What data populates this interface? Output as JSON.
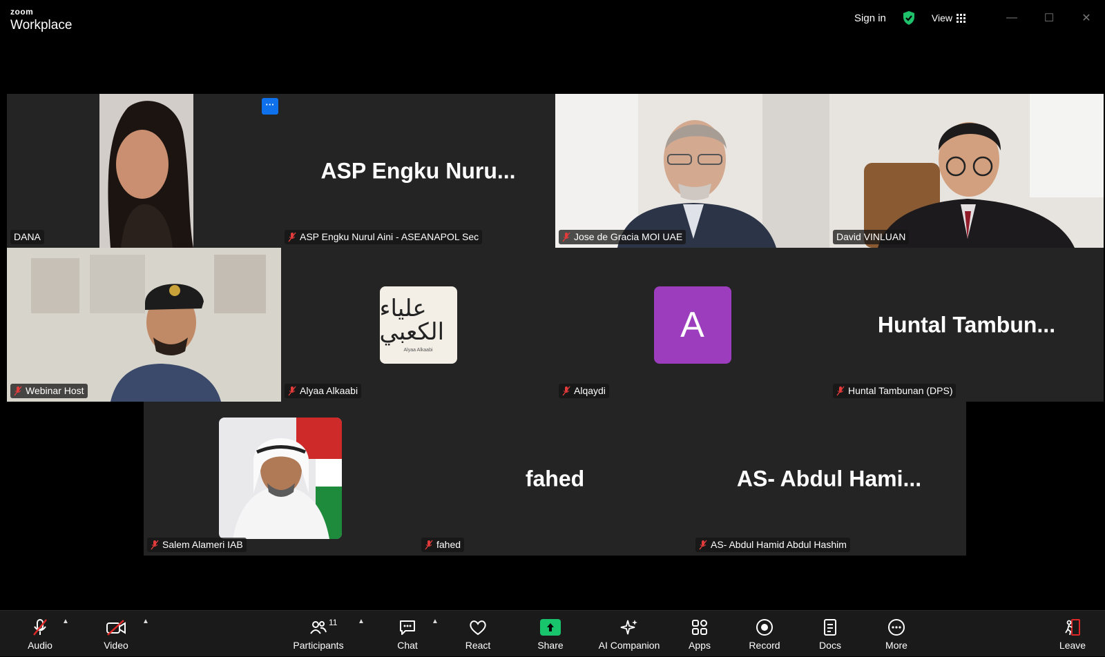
{
  "app": {
    "logo_small": "zoom",
    "logo_main": "Workplace"
  },
  "titlebar": {
    "signin": "Sign in",
    "view": "View"
  },
  "tiles": {
    "dana": {
      "caption": "DANA"
    },
    "asp": {
      "big": "ASP Engku Nuru...",
      "caption": "ASP Engku Nurul Aini - ASEANAPOL Sec"
    },
    "jose": {
      "caption": "Jose de Gracia MOI UAE"
    },
    "david": {
      "caption": "David VINLUAN"
    },
    "host": {
      "caption": "Webinar Host"
    },
    "alyaa": {
      "caption": "Alyaa Alkaabi",
      "logo_text": "علياء الكعبي",
      "logo_sub": "Alyaa Alkaabi"
    },
    "alqaydi": {
      "caption": "Alqaydi",
      "letter": "A"
    },
    "huntal": {
      "big": "Huntal Tambun...",
      "caption": "Huntal Tambunan (DPS)"
    },
    "salem": {
      "caption": "Salem Alameri IAB"
    },
    "fahed": {
      "big": "fahed",
      "caption": "fahed"
    },
    "abdul": {
      "big": "AS- Abdul Hami...",
      "caption": "AS- Abdul Hamid Abdul Hashim"
    }
  },
  "toolbar": {
    "audio": "Audio",
    "video": "Video",
    "participants": "Participants",
    "participants_count": "11",
    "chat": "Chat",
    "react": "React",
    "share": "Share",
    "ai": "AI Companion",
    "apps": "Apps",
    "record": "Record",
    "docs": "Docs",
    "more": "More",
    "leave": "Leave"
  },
  "colors": {
    "active_border": "#1fdc8b",
    "share_green": "#19c56c",
    "avatar_purple": "#9b3dbd",
    "leave_red": "#e02828"
  }
}
